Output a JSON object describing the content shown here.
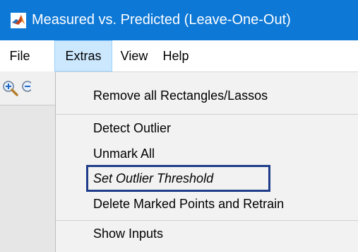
{
  "window": {
    "title": "Measured vs. Predicted  (Leave-One-Out)",
    "icon": "matlab-logo-icon",
    "titlebar_color": "#0d78d6"
  },
  "menubar": {
    "items": [
      {
        "label": "File"
      },
      {
        "label": "Extras",
        "active": true
      },
      {
        "label": "View"
      },
      {
        "label": "Help"
      }
    ]
  },
  "toolbar": {
    "icons": [
      "zoom-in-icon",
      "zoom-out-icon"
    ]
  },
  "extras_menu": {
    "items": [
      {
        "label": "Remove all Rectangles/Lassos"
      },
      {
        "label": "Detect Outlier"
      },
      {
        "label": "Unmark All"
      },
      {
        "label": "Set Outlier Threshold",
        "italic": true,
        "highlighted": true
      },
      {
        "label": "Delete Marked Points and Retrain"
      },
      {
        "label": "Show Inputs"
      }
    ],
    "highlight_color": "#1f3d8a"
  }
}
